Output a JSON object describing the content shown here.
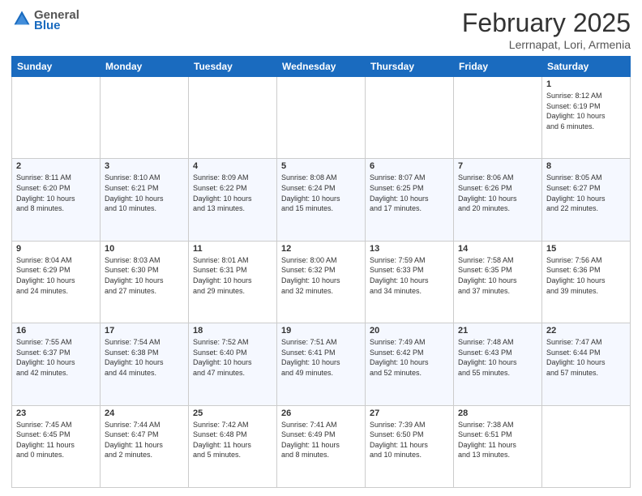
{
  "header": {
    "logo": {
      "general": "General",
      "blue": "Blue"
    },
    "title": "February 2025",
    "subtitle": "Lerrnapat, Lori, Armenia"
  },
  "weekdays": [
    "Sunday",
    "Monday",
    "Tuesday",
    "Wednesday",
    "Thursday",
    "Friday",
    "Saturday"
  ],
  "weeks": [
    [
      {
        "day": "",
        "info": ""
      },
      {
        "day": "",
        "info": ""
      },
      {
        "day": "",
        "info": ""
      },
      {
        "day": "",
        "info": ""
      },
      {
        "day": "",
        "info": ""
      },
      {
        "day": "",
        "info": ""
      },
      {
        "day": "1",
        "info": "Sunrise: 8:12 AM\nSunset: 6:19 PM\nDaylight: 10 hours\nand 6 minutes."
      }
    ],
    [
      {
        "day": "2",
        "info": "Sunrise: 8:11 AM\nSunset: 6:20 PM\nDaylight: 10 hours\nand 8 minutes."
      },
      {
        "day": "3",
        "info": "Sunrise: 8:10 AM\nSunset: 6:21 PM\nDaylight: 10 hours\nand 10 minutes."
      },
      {
        "day": "4",
        "info": "Sunrise: 8:09 AM\nSunset: 6:22 PM\nDaylight: 10 hours\nand 13 minutes."
      },
      {
        "day": "5",
        "info": "Sunrise: 8:08 AM\nSunset: 6:24 PM\nDaylight: 10 hours\nand 15 minutes."
      },
      {
        "day": "6",
        "info": "Sunrise: 8:07 AM\nSunset: 6:25 PM\nDaylight: 10 hours\nand 17 minutes."
      },
      {
        "day": "7",
        "info": "Sunrise: 8:06 AM\nSunset: 6:26 PM\nDaylight: 10 hours\nand 20 minutes."
      },
      {
        "day": "8",
        "info": "Sunrise: 8:05 AM\nSunset: 6:27 PM\nDaylight: 10 hours\nand 22 minutes."
      }
    ],
    [
      {
        "day": "9",
        "info": "Sunrise: 8:04 AM\nSunset: 6:29 PM\nDaylight: 10 hours\nand 24 minutes."
      },
      {
        "day": "10",
        "info": "Sunrise: 8:03 AM\nSunset: 6:30 PM\nDaylight: 10 hours\nand 27 minutes."
      },
      {
        "day": "11",
        "info": "Sunrise: 8:01 AM\nSunset: 6:31 PM\nDaylight: 10 hours\nand 29 minutes."
      },
      {
        "day": "12",
        "info": "Sunrise: 8:00 AM\nSunset: 6:32 PM\nDaylight: 10 hours\nand 32 minutes."
      },
      {
        "day": "13",
        "info": "Sunrise: 7:59 AM\nSunset: 6:33 PM\nDaylight: 10 hours\nand 34 minutes."
      },
      {
        "day": "14",
        "info": "Sunrise: 7:58 AM\nSunset: 6:35 PM\nDaylight: 10 hours\nand 37 minutes."
      },
      {
        "day": "15",
        "info": "Sunrise: 7:56 AM\nSunset: 6:36 PM\nDaylight: 10 hours\nand 39 minutes."
      }
    ],
    [
      {
        "day": "16",
        "info": "Sunrise: 7:55 AM\nSunset: 6:37 PM\nDaylight: 10 hours\nand 42 minutes."
      },
      {
        "day": "17",
        "info": "Sunrise: 7:54 AM\nSunset: 6:38 PM\nDaylight: 10 hours\nand 44 minutes."
      },
      {
        "day": "18",
        "info": "Sunrise: 7:52 AM\nSunset: 6:40 PM\nDaylight: 10 hours\nand 47 minutes."
      },
      {
        "day": "19",
        "info": "Sunrise: 7:51 AM\nSunset: 6:41 PM\nDaylight: 10 hours\nand 49 minutes."
      },
      {
        "day": "20",
        "info": "Sunrise: 7:49 AM\nSunset: 6:42 PM\nDaylight: 10 hours\nand 52 minutes."
      },
      {
        "day": "21",
        "info": "Sunrise: 7:48 AM\nSunset: 6:43 PM\nDaylight: 10 hours\nand 55 minutes."
      },
      {
        "day": "22",
        "info": "Sunrise: 7:47 AM\nSunset: 6:44 PM\nDaylight: 10 hours\nand 57 minutes."
      }
    ],
    [
      {
        "day": "23",
        "info": "Sunrise: 7:45 AM\nSunset: 6:45 PM\nDaylight: 11 hours\nand 0 minutes."
      },
      {
        "day": "24",
        "info": "Sunrise: 7:44 AM\nSunset: 6:47 PM\nDaylight: 11 hours\nand 2 minutes."
      },
      {
        "day": "25",
        "info": "Sunrise: 7:42 AM\nSunset: 6:48 PM\nDaylight: 11 hours\nand 5 minutes."
      },
      {
        "day": "26",
        "info": "Sunrise: 7:41 AM\nSunset: 6:49 PM\nDaylight: 11 hours\nand 8 minutes."
      },
      {
        "day": "27",
        "info": "Sunrise: 7:39 AM\nSunset: 6:50 PM\nDaylight: 11 hours\nand 10 minutes."
      },
      {
        "day": "28",
        "info": "Sunrise: 7:38 AM\nSunset: 6:51 PM\nDaylight: 11 hours\nand 13 minutes."
      },
      {
        "day": "",
        "info": ""
      }
    ]
  ]
}
